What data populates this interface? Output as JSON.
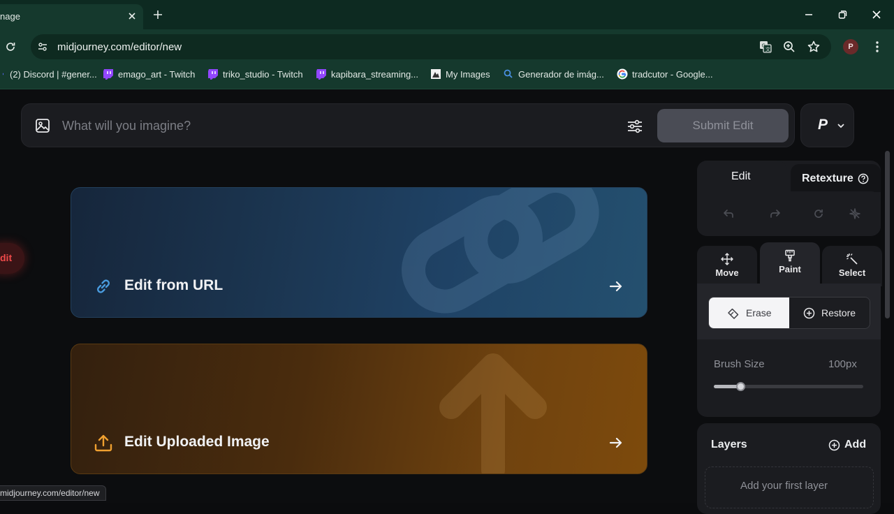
{
  "browser": {
    "tab_title": "nage",
    "url": "midjourney.com/editor/new",
    "profile_initial": "P",
    "bookmarks": [
      {
        "label": "(2) Discord | #gener...",
        "icon": "discord-icon"
      },
      {
        "label": "emago_art - Twitch",
        "icon": "twitch-icon"
      },
      {
        "label": "triko_studio - Twitch",
        "icon": "twitch-icon"
      },
      {
        "label": "kapibara_streaming...",
        "icon": "twitch-icon"
      },
      {
        "label": "My Images",
        "icon": "image-file-icon"
      },
      {
        "label": "Generador de imág...",
        "icon": "search-icon"
      },
      {
        "label": "tradcutor - Google...",
        "icon": "google-icon"
      }
    ],
    "status_url": "midjourney.com/editor/new"
  },
  "prompt": {
    "placeholder": "What will you imagine?",
    "submit_label": "Submit Edit"
  },
  "user": {
    "initial": "P"
  },
  "side_pill": {
    "label": "dit"
  },
  "cards": [
    {
      "label": "Edit from URL",
      "icon": "link-icon",
      "accent": "#4a9de0"
    },
    {
      "label": "Edit Uploaded Image",
      "icon": "upload-icon",
      "accent": "#f0a030"
    }
  ],
  "panel": {
    "tabs": {
      "edit": "Edit",
      "retexture": "Retexture"
    },
    "modes": [
      {
        "label": "Move",
        "icon": "move-icon"
      },
      {
        "label": "Paint",
        "icon": "paint-brush-icon"
      },
      {
        "label": "Select",
        "icon": "magic-select-icon"
      }
    ],
    "active_mode": "Paint",
    "erase_label": "Erase",
    "restore_label": "Restore",
    "brush_size_label": "Brush Size",
    "brush_size_value": "100px",
    "brush_size_fraction": 0.18,
    "layers_title": "Layers",
    "layers_add": "Add",
    "layers_empty": "Add your first layer"
  }
}
